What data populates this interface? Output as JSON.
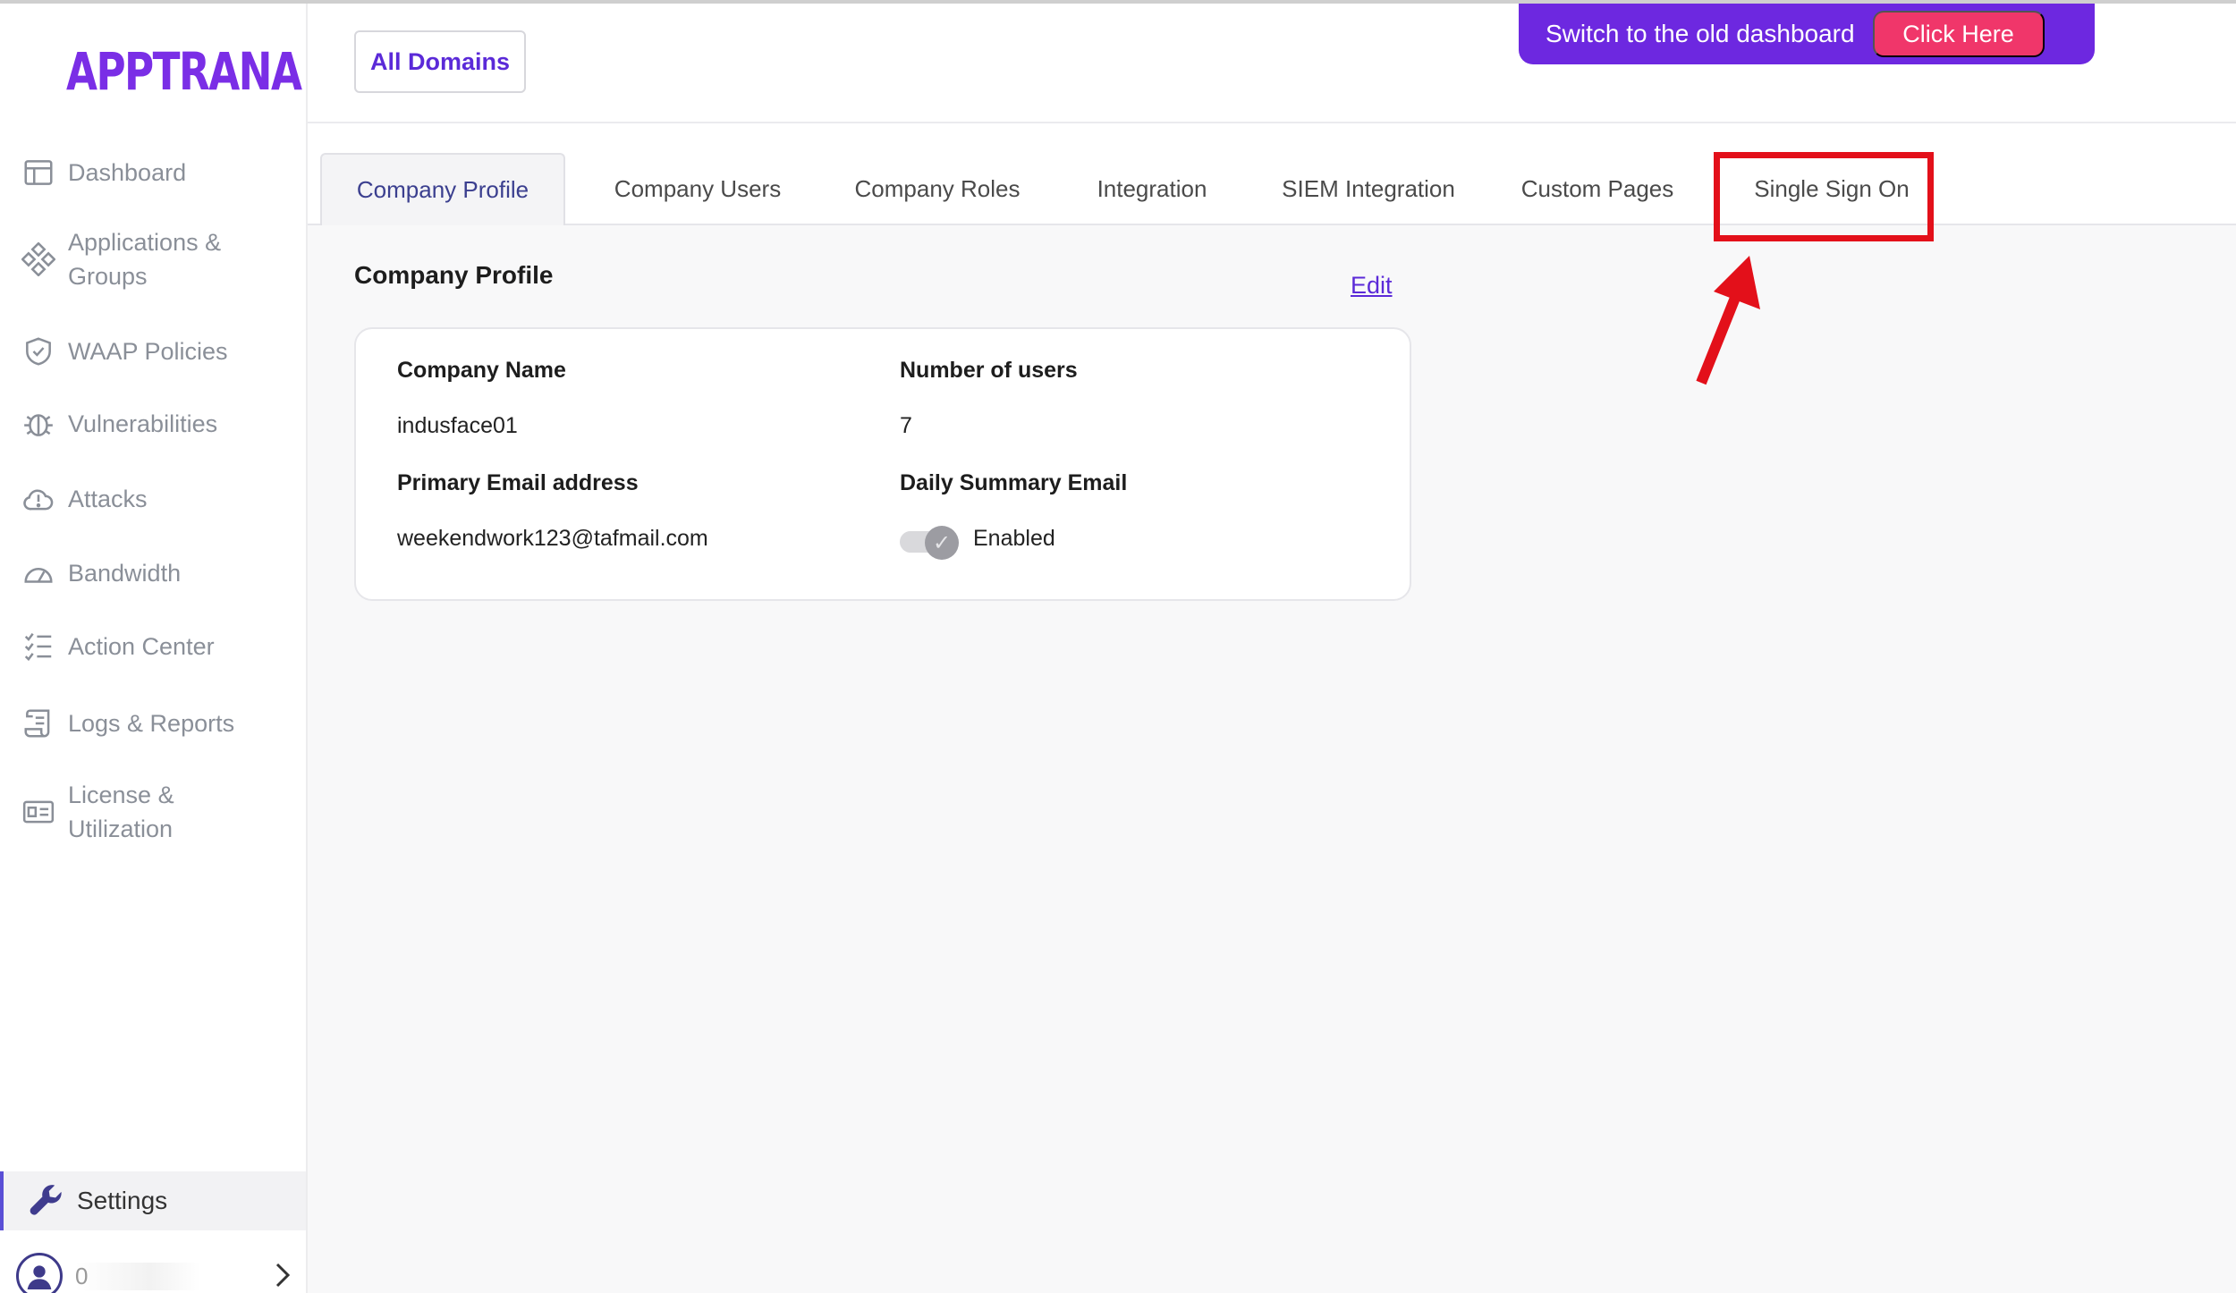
{
  "brand": {
    "logo_text": "APPTRANA",
    "logo_color": "#7a2ee6"
  },
  "sidebar": {
    "items": [
      {
        "label": "Dashboard",
        "icon": "dashboard-icon"
      },
      {
        "label": "Applications &\nGroups",
        "icon": "apps-icon"
      },
      {
        "label": "WAAP Policies",
        "icon": "shield-icon"
      },
      {
        "label": "Vulnerabilities",
        "icon": "bug-icon"
      },
      {
        "label": "Attacks",
        "icon": "cloud-alert-icon"
      },
      {
        "label": "Bandwidth",
        "icon": "gauge-icon"
      },
      {
        "label": "Action Center",
        "icon": "checklist-icon"
      },
      {
        "label": "Logs & Reports",
        "icon": "scroll-icon"
      },
      {
        "label": "License &\nUtilization",
        "icon": "license-icon"
      }
    ],
    "settings_label": "Settings",
    "user_name": "0"
  },
  "header": {
    "all_domains_label": "All Domains",
    "banner_text": "Switch to the old dashboard",
    "banner_button": "Click Here",
    "banner_color": "#6d28e0",
    "banner_button_color": "#f0366a"
  },
  "tabs": [
    {
      "label": "Company Profile",
      "active": true
    },
    {
      "label": "Company Users"
    },
    {
      "label": "Company Roles"
    },
    {
      "label": "Integration"
    },
    {
      "label": "SIEM Integration"
    },
    {
      "label": "Custom Pages"
    },
    {
      "label": "Single Sign On",
      "highlighted": true
    }
  ],
  "annotation": {
    "highlight_color": "#e3101a"
  },
  "profile": {
    "section_title": "Company Profile",
    "edit_label": "Edit",
    "company_name_label": "Company Name",
    "company_name_value": "indusface01",
    "users_label": "Number of users",
    "users_value": "7",
    "email_label": "Primary Email address",
    "email_value": "weekendwork123@tafmail.com",
    "daily_label": "Daily Summary Email",
    "daily_value": "Enabled",
    "daily_enabled": true
  }
}
